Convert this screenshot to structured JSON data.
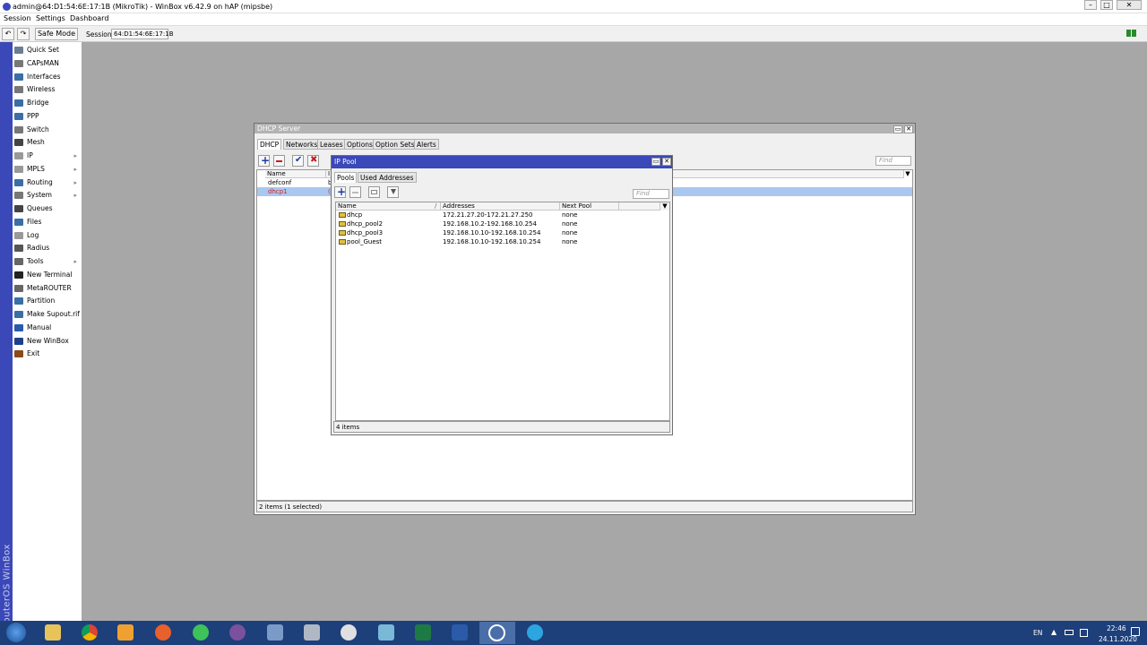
{
  "window": {
    "title": "admin@64:D1:54:6E:17:1B (MikroTik) - WinBox v6.42.9 on hAP (mipsbe)"
  },
  "menu": {
    "session": "Session",
    "settings": "Settings",
    "dashboard": "Dashboard"
  },
  "toolbar": {
    "undo": "↶",
    "redo": "↷",
    "safe_mode": "Safe Mode",
    "session_label": "Session:",
    "session_value": "64:D1:54:6E:17:1B"
  },
  "sidebar": {
    "brand": "RouterOS WinBox",
    "items": [
      {
        "label": "Quick Set",
        "icon": "quick-set-icon",
        "color": "#6a7d94"
      },
      {
        "label": "CAPsMAN",
        "icon": "capsman-icon",
        "color": "#777777"
      },
      {
        "label": "Interfaces",
        "icon": "interfaces-icon",
        "color": "#3b6ea5"
      },
      {
        "label": "Wireless",
        "icon": "wireless-icon",
        "color": "#777777"
      },
      {
        "label": "Bridge",
        "icon": "bridge-icon",
        "color": "#3b6ea5"
      },
      {
        "label": "PPP",
        "icon": "ppp-icon",
        "color": "#3b6ea5"
      },
      {
        "label": "Switch",
        "icon": "switch-icon",
        "color": "#777777"
      },
      {
        "label": "Mesh",
        "icon": "mesh-icon",
        "color": "#444444"
      },
      {
        "label": "IP",
        "icon": "ip-icon",
        "color": "#999999",
        "submenu": true
      },
      {
        "label": "MPLS",
        "icon": "mpls-icon",
        "color": "#999999",
        "submenu": true
      },
      {
        "label": "Routing",
        "icon": "routing-icon",
        "color": "#3b6ea5",
        "submenu": true
      },
      {
        "label": "System",
        "icon": "system-icon",
        "color": "#777777",
        "submenu": true
      },
      {
        "label": "Queues",
        "icon": "queues-icon",
        "color": "#444444"
      },
      {
        "label": "Files",
        "icon": "files-icon",
        "color": "#3b6ea5"
      },
      {
        "label": "Log",
        "icon": "log-icon",
        "color": "#999999"
      },
      {
        "label": "Radius",
        "icon": "radius-icon",
        "color": "#555555"
      },
      {
        "label": "Tools",
        "icon": "tools-icon",
        "color": "#666666",
        "submenu": true
      },
      {
        "label": "New Terminal",
        "icon": "terminal-icon",
        "color": "#222222"
      },
      {
        "label": "MetaROUTER",
        "icon": "metarouter-icon",
        "color": "#666666"
      },
      {
        "label": "Partition",
        "icon": "partition-icon",
        "color": "#3b6ea5"
      },
      {
        "label": "Make Supout.rif",
        "icon": "supout-icon",
        "color": "#3b6ea5"
      },
      {
        "label": "Manual",
        "icon": "manual-icon",
        "color": "#2a5aa8"
      },
      {
        "label": "New WinBox",
        "icon": "winbox-icon",
        "color": "#1f3f8a"
      },
      {
        "label": "Exit",
        "icon": "exit-icon",
        "color": "#8a4a1a"
      }
    ]
  },
  "dhcp": {
    "title": "DHCP Server",
    "tabs": [
      "DHCP",
      "Networks",
      "Leases",
      "Options",
      "Option Sets",
      "Alerts"
    ],
    "find_placeholder": "Find",
    "col_name": "Name",
    "col_i": "I",
    "rows": [
      {
        "name": "defconf",
        "extra": "b"
      },
      {
        "name": "dhcp1",
        "extra": "("
      }
    ],
    "status": "2 items (1 selected)"
  },
  "pool": {
    "title": "IP Pool",
    "tabs": [
      "Pools",
      "Used Addresses"
    ],
    "find_placeholder": "Find",
    "columns": [
      "Name",
      "Addresses",
      "Next Pool"
    ],
    "rows": [
      {
        "name": "dhcp",
        "addresses": "172.21.27.20-172.21.27.250",
        "next": "none"
      },
      {
        "name": "dhcp_pool2",
        "addresses": "192.168.10.2-192.168.10.254",
        "next": "none"
      },
      {
        "name": "dhcp_pool3",
        "addresses": "192.168.10.10-192.168.10.254",
        "next": "none"
      },
      {
        "name": "pool_Guest",
        "addresses": "192.168.10.10-192.168.10.254",
        "next": "none"
      }
    ],
    "status": "4 items"
  },
  "taskbar": {
    "lang": "EN",
    "time": "22:46",
    "date": "24.11.2020"
  },
  "colors": {
    "accent": "#3b48b8",
    "selected_row": "#a9c7ef",
    "selected_text": "#d42020",
    "taskbar": "#1d3f7a"
  }
}
